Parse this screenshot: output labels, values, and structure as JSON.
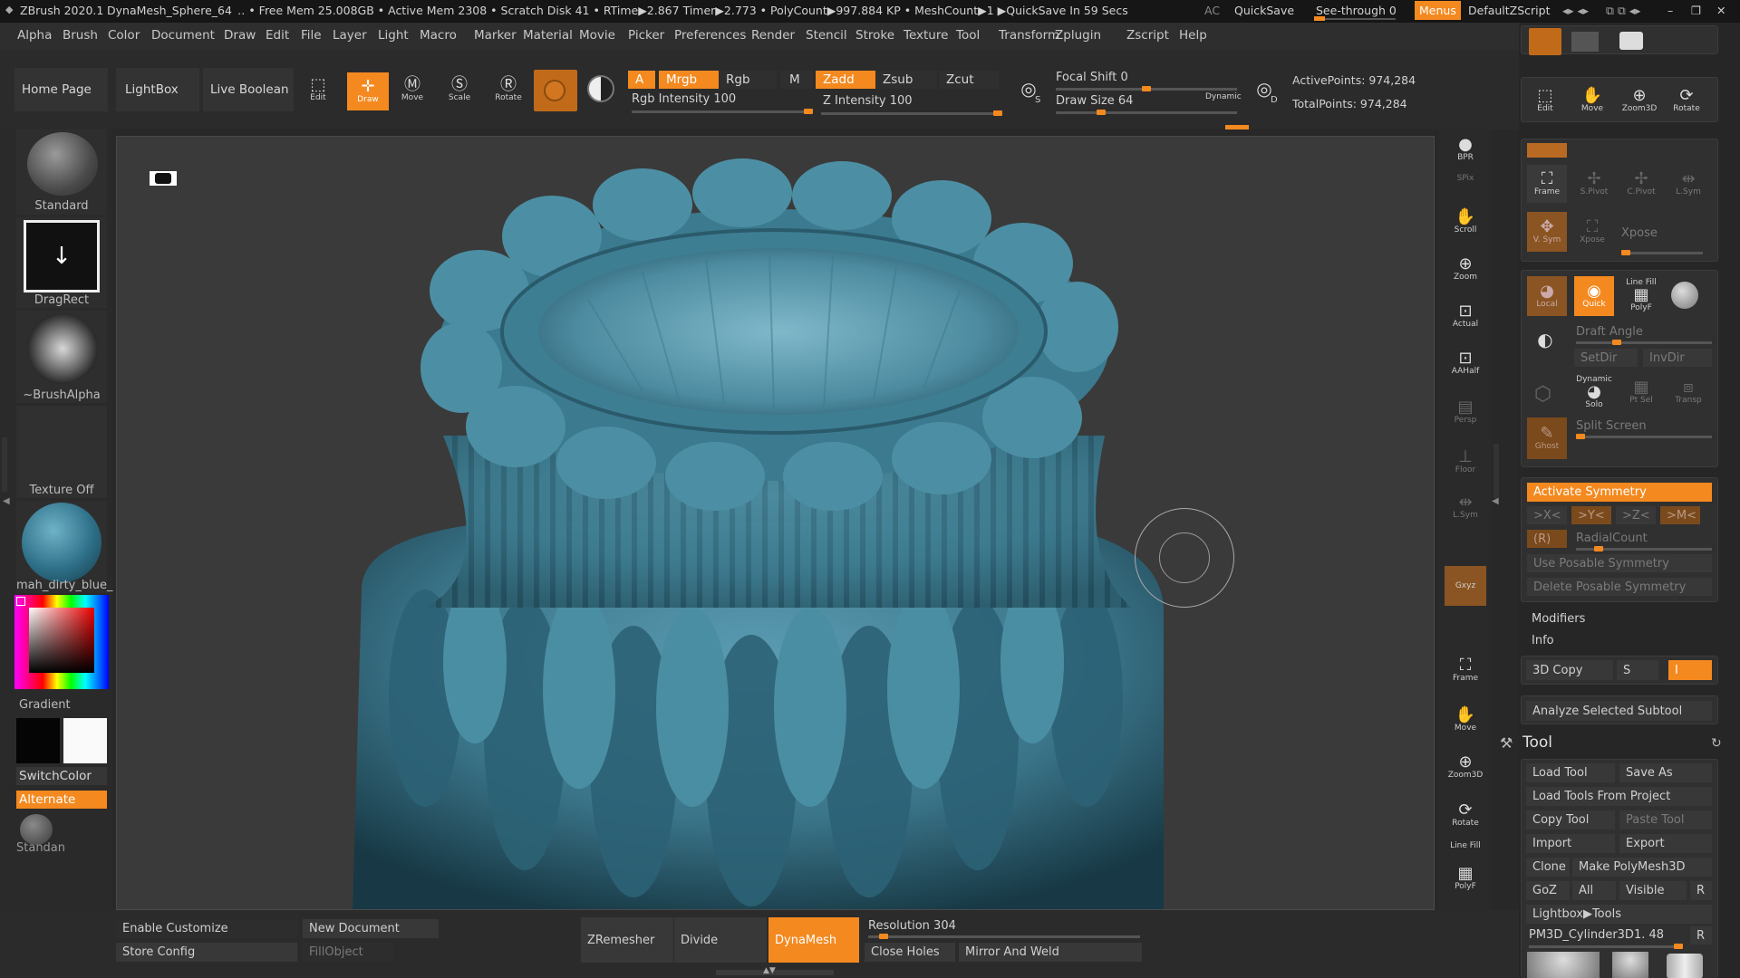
{
  "titlebar": {
    "app": "ZBrush 2020.1",
    "doc": "DynaMesh_Sphere_64",
    "stats": "‥ • Free Mem 25.008GB • Active Mem 2308 • Scratch Disk 41 •  RTime▶2.867 Timer▶2.773 • PolyCount▶997.884 KP  • MeshCount▶1  ▶QuickSave In 59 Secs",
    "ac": "AC",
    "quicksave": "QuickSave",
    "seethrough": "See-through  0",
    "menus": "Menus",
    "script": "DefaultZScript"
  },
  "menubar": [
    "Alpha",
    "Brush",
    "Color",
    "Document",
    "Draw",
    "Edit",
    "File",
    "Layer",
    "Light",
    "Macro",
    "Marker",
    "Material",
    "Movie",
    "Picker",
    "Preferences",
    "Render",
    "Stencil",
    "Stroke",
    "Texture",
    "Tool",
    "Transform",
    "Zplugin",
    "Zscript",
    "Help"
  ],
  "toolbar": {
    "home": "Home Page",
    "lightbox": "LightBox",
    "liveboolean": "Live Boolean",
    "edit": "Edit",
    "draw": "Draw",
    "move": "Move",
    "scale": "Scale",
    "rotate": "Rotate",
    "a": "A",
    "mrgb": "Mrgb",
    "rgb": "Rgb",
    "m": "M",
    "zadd": "Zadd",
    "zsub": "Zsub",
    "zcut": "Zcut",
    "rgb_intensity": "Rgb Intensity 100",
    "z_intensity": "Z Intensity 100",
    "focal_shift": "Focal Shift 0",
    "draw_size": "Draw Size 64",
    "dynamic": "Dynamic",
    "active_points": "ActivePoints: 974,284",
    "total_points": "TotalPoints: 974,284",
    "s": "S",
    "d": "D"
  },
  "leftshelf": {
    "brush": "Standard",
    "stroke": "DragRect",
    "alpha": "~BrushAlpha",
    "texture": "Texture Off",
    "material": "mah_dirty_blue_",
    "gradient": "Gradient",
    "switchcolor": "SwitchColor",
    "alternate": "Alternate",
    "brush2": "Standan"
  },
  "rightshelf": [
    "BPR",
    "SPix",
    "Scroll",
    "Zoom",
    "Actual",
    "AAHalf",
    "Persp",
    "Floor",
    "L.Sym",
    "",
    "Gxyz",
    "",
    "",
    "Frame",
    "Move",
    "Zoom3D",
    "Rotate",
    "Line Fill",
    "PolyF",
    "Transp",
    "Ghost",
    "Dynamic"
  ],
  "rpanel": {
    "top_icons": [
      "Edit",
      "Move",
      "Zoom3D",
      "Rotate"
    ],
    "frame": "Frame",
    "spivot": "S.Pivot",
    "cpivot": "C.Pivot",
    "lsym": "L.Sym",
    "vsym": "V. Sym",
    "xpose_small": "Xpose",
    "xpose": "Xpose",
    "local": "Local",
    "quick": "Quick",
    "linefill": "Line Fill",
    "polyf": "PolyF",
    "draft_angle": "Draft Angle",
    "setdir": "SetDir",
    "invdir": "InvDir",
    "dynamic": "Dynamic",
    "solo": "Solo",
    "ptsel": "Pt Sel",
    "transp": "Transp",
    "ghost": "Ghost",
    "split_screen": "Split Screen",
    "activate_symmetry": "Activate Symmetry",
    "x": ">X<",
    "y": ">Y<",
    "z": ">Z<",
    "m": ">M<",
    "r": "(R)",
    "radialcount": "RadialCount",
    "use_posable": "Use Posable Symmetry",
    "delete_posable": "Delete Posable Symmetry",
    "modifiers": "Modifiers",
    "info": "Info",
    "copy3d": "3D Copy",
    "s": "S",
    "i": "I",
    "analyze": "Analyze Selected Subtool",
    "tool": "Tool",
    "load_tool": "Load Tool",
    "save_as": "Save As",
    "load_from_project": "Load Tools From Project",
    "copy_tool": "Copy Tool",
    "paste_tool": "Paste Tool",
    "import": "Import",
    "export": "Export",
    "clone": "Clone",
    "make_polymesh": "Make PolyMesh3D",
    "goz": "GoZ",
    "all": "All",
    "visible": "Visible",
    "r2": "R",
    "lightbox_tools": "Lightbox▶Tools",
    "current_tool": "PM3D_Cylinder3D1. 48",
    "r3": "R"
  },
  "bottombar": {
    "enable_customize": "Enable Customize",
    "new_document": "New Document",
    "store_config": "Store Config",
    "fillobject": "FillObject",
    "zremesher": "ZRemesher",
    "divide": "Divide",
    "dynamesh": "DynaMesh",
    "resolution": "Resolution 304",
    "close_holes": "Close Holes",
    "mirror_weld": "Mirror And Weld"
  },
  "colors": {
    "accent": "#f4891f",
    "mesh": "#3f7f93"
  }
}
